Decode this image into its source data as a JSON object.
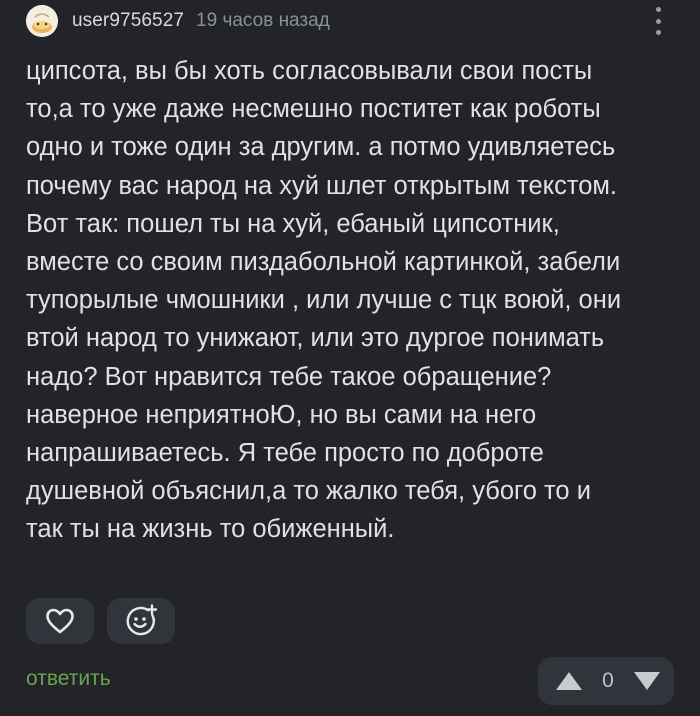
{
  "header": {
    "username": "user9756527",
    "timestamp": "19 часов назад",
    "avatar_icon": "avatar-image",
    "more_icon": "more-vertical-icon"
  },
  "comment": {
    "lines": [
      "ципсота, вы бы хоть согласовывали свои посты",
      "то,а то уже даже несмешно поститет как роботы",
      "одно и тоже один за другим. а потмо удивляетесь",
      "почему вас народ на хуй шлет открытым текстом.",
      "Вот так: пошел ты на хуй, ебаный ципсотник,",
      "вместе со своим пиздабольной картинкой, забели",
      "тупорылые чмошники , или лучше с тцк воюй, они",
      "втой народ то унижают, или это дургое понимать",
      "надо? Вот нравится тебе такое обращение?",
      "наверное неприятноЮ, но вы сами на него",
      "напрашиваетесь. Я тебе просто по доброте",
      "душевной объяснил,а то жалко тебя, убого то и",
      "так ты на жизнь то обиженный."
    ]
  },
  "actions": {
    "like_icon": "heart-icon",
    "emoji_icon": "add-emoji-icon",
    "reply_label": "ответить",
    "vote_count": "0",
    "upvote_icon": "arrow-up-icon",
    "downvote_icon": "arrow-down-icon"
  },
  "colors": {
    "background": "#222429",
    "text": "#dfe1e4",
    "muted": "#8b8f96",
    "accent_green": "#6aa34a",
    "button_bg": "#31343a"
  }
}
